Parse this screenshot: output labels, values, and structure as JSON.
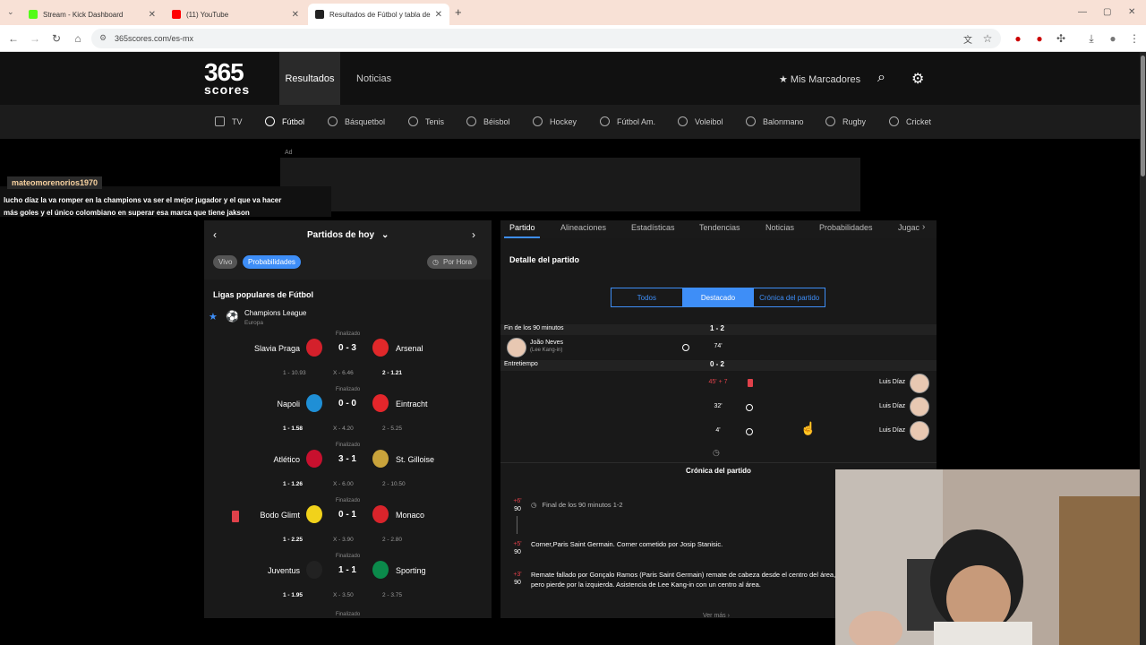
{
  "browser": {
    "tabs": [
      {
        "title": "Stream - Kick Dashboard",
        "color": "#53fc18"
      },
      {
        "title": "(11) YouTube",
        "color": "#ff0000"
      },
      {
        "title": "Resultados de Fútbol y tabla de",
        "color": "#222222"
      }
    ],
    "new_tab": "+",
    "url": "365scores.com/es-mx"
  },
  "header": {
    "logo_big": "365",
    "logo_small": "scores",
    "nav_resultados": "Resultados",
    "nav_noticias": "Noticias",
    "mis_marcadores": "Mis Marcadores"
  },
  "sports": [
    "TV",
    "Fútbol",
    "Básquetbol",
    "Tenis",
    "Béisbol",
    "Hockey",
    "Fútbol Am.",
    "Voleibol",
    "Balonmano",
    "Rugby",
    "Cricket"
  ],
  "ad_label": "Ad",
  "chat": {
    "user": "mateomorenorios1970",
    "message_line1": "lucho díaz la va romper en la champions va ser el mejor jugador y el que va hacer",
    "message_line2": "más goles y el único colombiano en superar esa marca que tiene jakson"
  },
  "left": {
    "date_title": "Partidos de hoy",
    "pill_vivo": "Vivo",
    "pill_probabilidades": "Probabilidades",
    "pill_por_hora": "Por Hora",
    "ligas_title": "Ligas populares de Fútbol",
    "league_name": "Champions League",
    "league_region": "Europa",
    "matches": [
      {
        "status": "Finalizado",
        "home": "Slavia Praga",
        "score": "0 - 3",
        "away": "Arsenal",
        "o1": "1 - 10.93",
        "ox": "X - 6.46",
        "o2": "2 - 1.21",
        "home_color": "#d4202b",
        "away_color": "#e0282a",
        "red_card": false
      },
      {
        "status": "Finalizado",
        "home": "Napoli",
        "score": "0 - 0",
        "away": "Eintracht",
        "o1": "1 - 1.58",
        "ox": "X - 4.20",
        "o2": "2 - 5.25",
        "home_color": "#1f8fd6",
        "away_color": "#e3262b",
        "red_card": false
      },
      {
        "status": "Finalizado",
        "home": "Atlético",
        "score": "3 - 1",
        "away": "St. Gilloise",
        "o1": "1 - 1.26",
        "ox": "X - 6.00",
        "o2": "2 - 10.50",
        "home_color": "#c8102e",
        "away_color": "#c9a33b",
        "red_card": false
      },
      {
        "status": "Finalizado",
        "home": "Bodo Glimt",
        "score": "0 - 1",
        "away": "Monaco",
        "o1": "1 - 2.25",
        "ox": "X - 3.90",
        "o2": "2 - 2.80",
        "home_color": "#f1d21b",
        "away_color": "#d9242b",
        "red_card": true
      },
      {
        "status": "Finalizado",
        "home": "Juventus",
        "score": "1 - 1",
        "away": "Sporting",
        "o1": "1 - 1.95",
        "ox": "X - 3.50",
        "o2": "2 - 3.75",
        "home_color": "#222222",
        "away_color": "#0b8a4b",
        "red_card": false
      }
    ],
    "next_status": "Finalizado"
  },
  "right": {
    "tabs": [
      "Partido",
      "Alineaciones",
      "Estadísticas",
      "Tendencias",
      "Noticias",
      "Probabilidades",
      "Jugac"
    ],
    "detalle_title": "Detalle del partido",
    "segments": [
      "Todos",
      "Destacado",
      "Crónica del partido"
    ],
    "section_fin": "Fin de los 90 minutos",
    "section_fin_score": "1 - 2",
    "event1": {
      "player": "João Neves",
      "assist": "(Lee Kang-in)",
      "time": "74'"
    },
    "section_ent": "Entretiempo",
    "section_ent_score": "0 - 2",
    "events_away": [
      {
        "time": "45' + 7",
        "player": "Luis Díaz",
        "type": "red-card"
      },
      {
        "time": "32'",
        "player": "Luis Díaz",
        "type": "goal"
      },
      {
        "time": "4'",
        "player": "Luis Díaz",
        "type": "goal"
      }
    ],
    "cronica_title": "Crónica del partido",
    "cronica": [
      {
        "min_extra": "+6'",
        "min": "90",
        "text": "Final de los 90 minutos 1-2"
      },
      {
        "min_extra": "+5'",
        "min": "90",
        "text": "Corner,Paris Saint Germain. Corner cometido por Josip Stanisic."
      },
      {
        "min_extra": "+3'",
        "min": "90",
        "text": "Remate fallado por Gonçalo Ramos (Paris Saint Germain) remate de cabeza desde el centro del área, pero pierde por la izquierda. Asistencia de Lee Kang-in con un centro al área."
      }
    ],
    "ver_mas": "Ver más"
  }
}
